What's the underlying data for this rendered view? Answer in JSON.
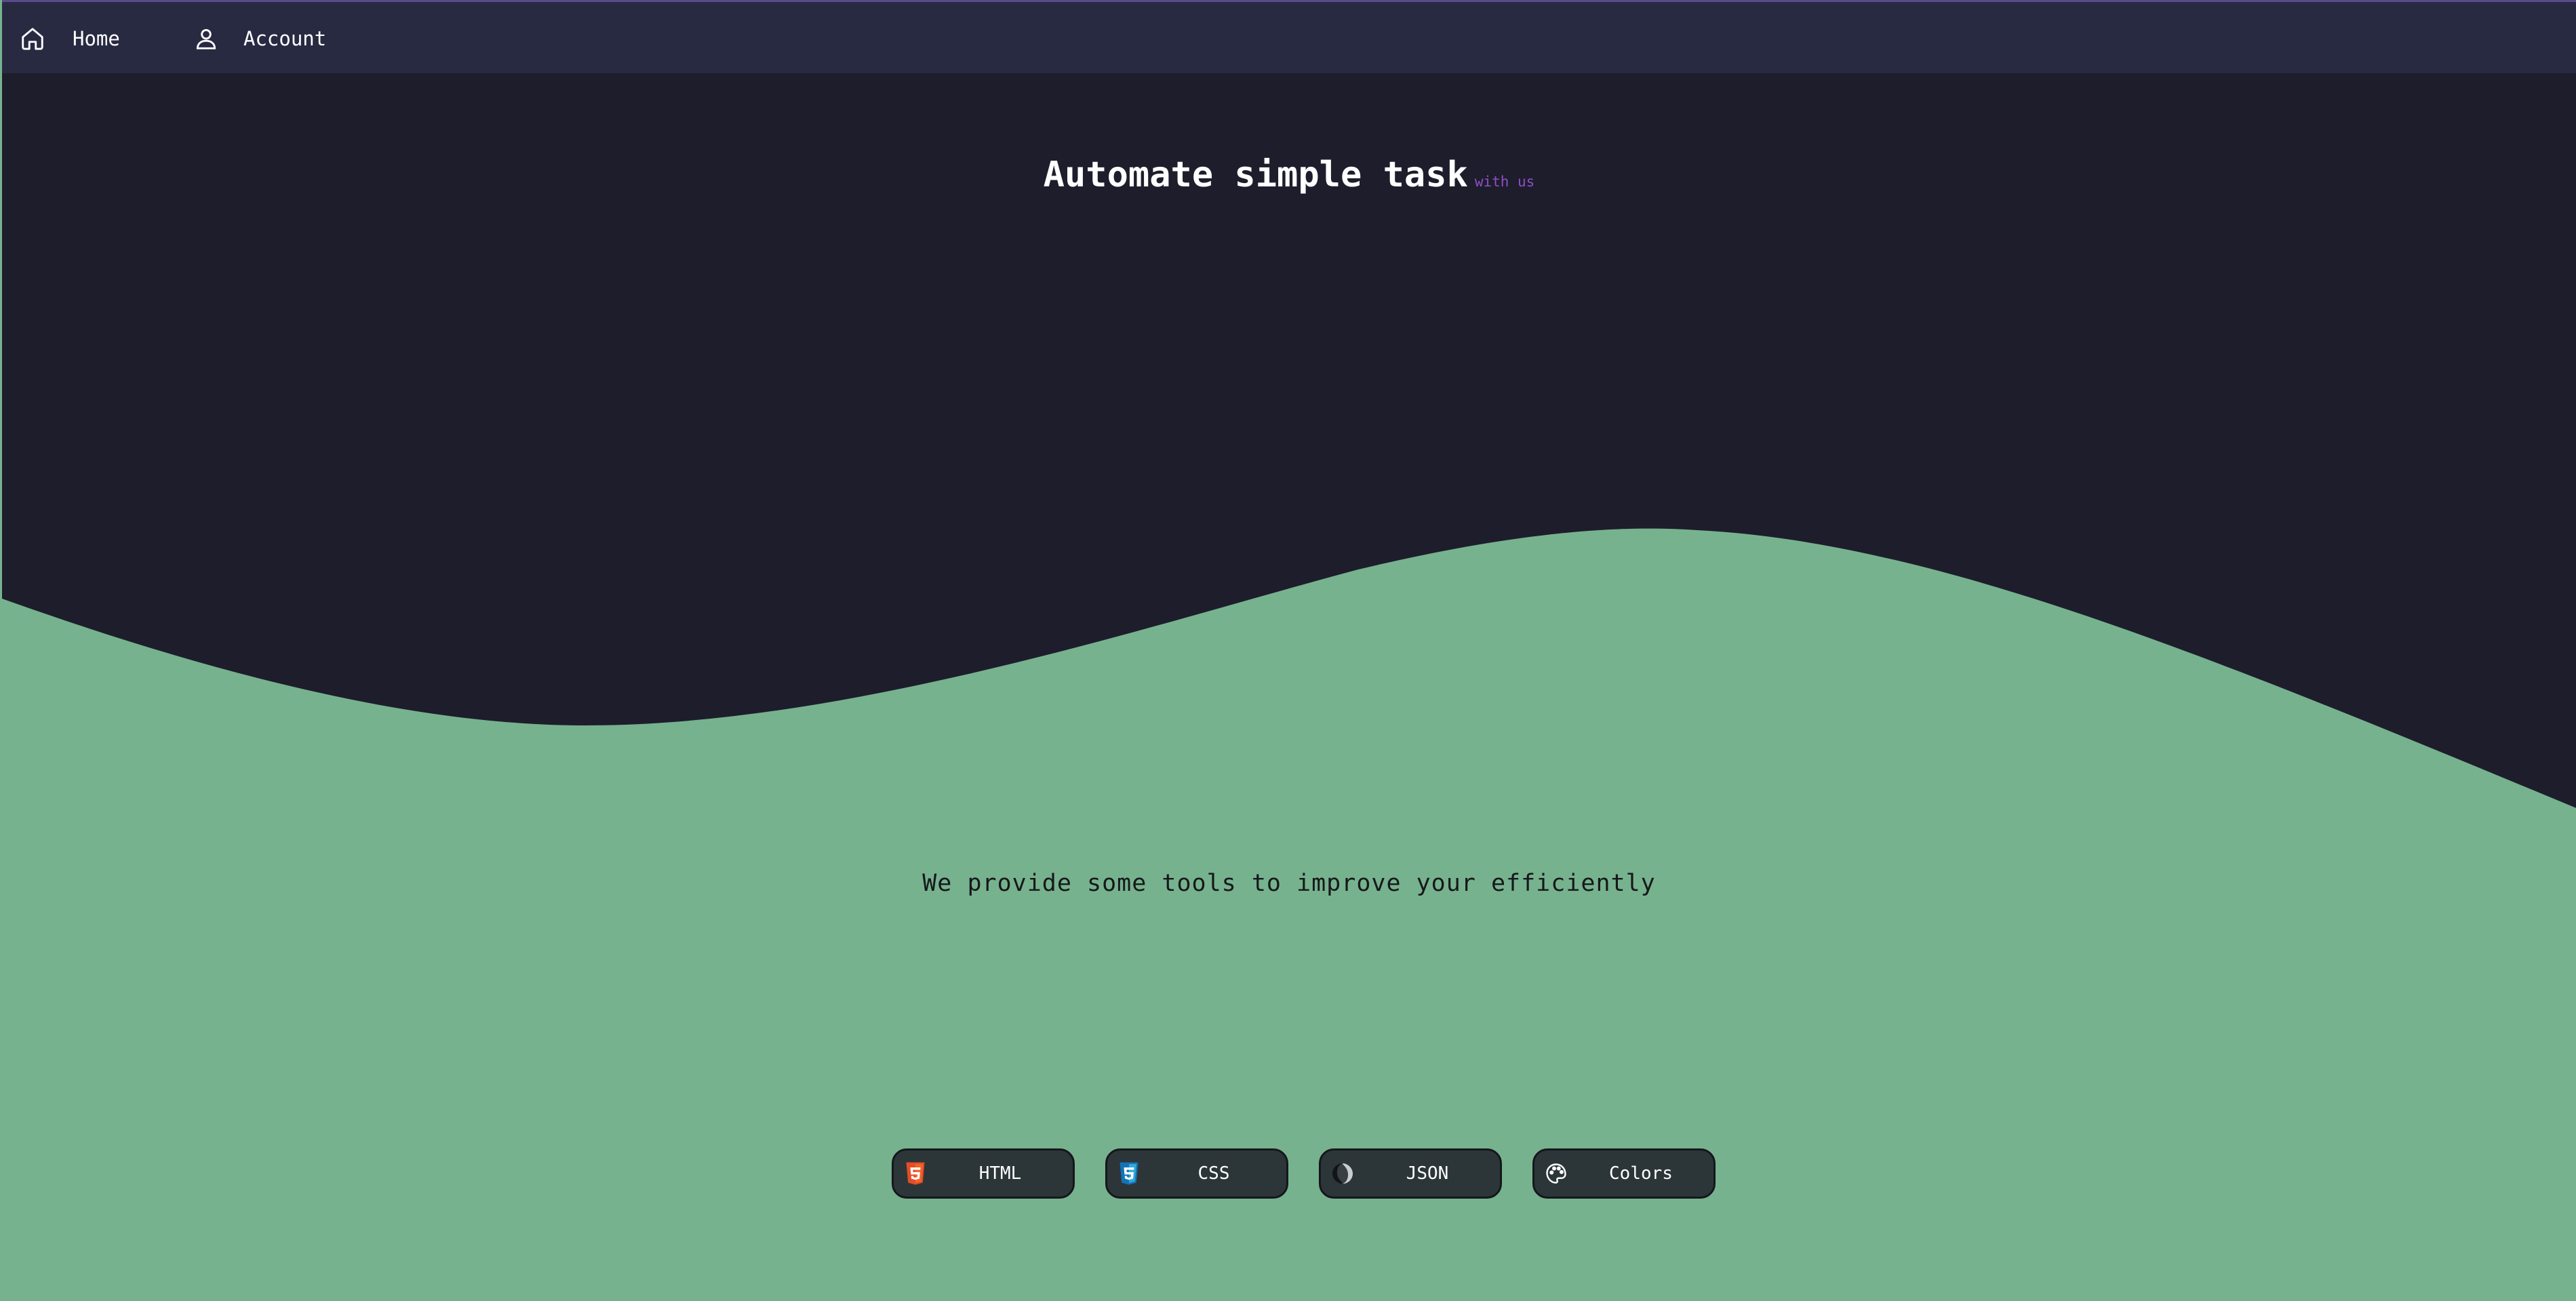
{
  "nav": {
    "items": [
      {
        "label": "Home",
        "icon": "home-icon"
      },
      {
        "label": "Account",
        "icon": "user-icon"
      }
    ]
  },
  "hero": {
    "title": "Automate simple task",
    "subtitle": "with us"
  },
  "tagline": "We provide some tools to improve your efficiently",
  "tools": [
    {
      "label": "HTML",
      "icon": "html5-icon"
    },
    {
      "label": "CSS",
      "icon": "css3-icon"
    },
    {
      "label": "JSON",
      "icon": "json-icon"
    },
    {
      "label": "Colors",
      "icon": "palette-icon"
    }
  ],
  "colors": {
    "background": "#1e1d2c",
    "navbar": "#282a42",
    "wave": "#76b28e",
    "accent": "#8c4fc6",
    "button": "#2c3639"
  }
}
